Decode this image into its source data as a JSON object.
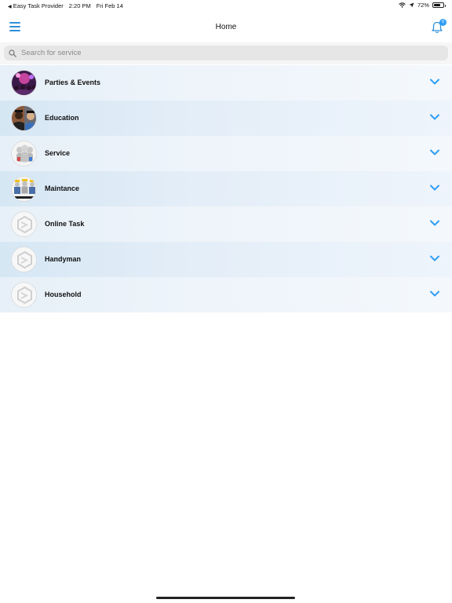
{
  "status_bar": {
    "back_app": "Easy Task Provider",
    "time": "2:20 PM",
    "date": "Fri Feb 14",
    "battery": "72%",
    "battery_level": 0.72
  },
  "nav": {
    "title": "Home",
    "menu_icon": "hamburger-menu-icon",
    "bell_icon": "bell-icon",
    "badge_count": "0"
  },
  "search": {
    "placeholder": "Search for service"
  },
  "categories": [
    {
      "label": "Parties & Events",
      "icon": "party-image"
    },
    {
      "label": "Education",
      "icon": "graduates-image"
    },
    {
      "label": "Service",
      "icon": "service-people-image"
    },
    {
      "label": "Maintance",
      "icon": "maintenance-team-image"
    },
    {
      "label": "Online Task",
      "icon": "placeholder-logo-icon"
    },
    {
      "label": "Handyman",
      "icon": "placeholder-logo-icon"
    },
    {
      "label": "Household",
      "icon": "placeholder-logo-icon"
    }
  ],
  "colors": {
    "accent": "#2f8fd8",
    "badge": "#2f9ef4",
    "row_light": "#e7f0f8",
    "row_dark": "#d6e7f4"
  }
}
